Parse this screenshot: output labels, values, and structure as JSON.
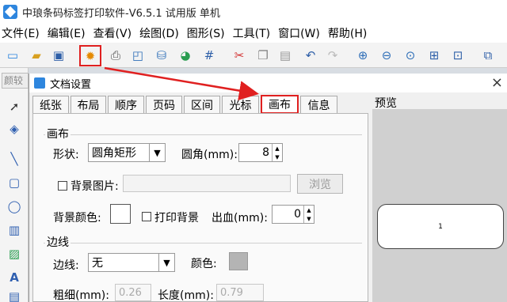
{
  "app": {
    "title": "中琅条码标签打印软件-V6.5.1 试用版 单机"
  },
  "menu": [
    "文件(E)",
    "编辑(E)",
    "查看(V)",
    "绘图(D)",
    "图形(S)",
    "工具(T)",
    "窗口(W)",
    "帮助(H)"
  ],
  "sidebar_ghost": "颜较",
  "dialog": {
    "title": "文档设置",
    "close": "×",
    "tabs": [
      "纸张",
      "布局",
      "顺序",
      "页码",
      "区间",
      "光标",
      "画布",
      "信息"
    ],
    "active_tab": "画布",
    "canvas_group": "画布",
    "shape_label": "形状:",
    "shape_value": "圆角矩形",
    "corner_label": "圆角(mm):",
    "corner_value": "8",
    "bg_image_label": "背景图片:",
    "browse_label": "浏览",
    "bg_color_label": "背景颜色:",
    "print_bg_label": "打印背景",
    "bleed_label": "出血(mm):",
    "bleed_value": "0",
    "border_group": "边线",
    "border_label": "边线:",
    "border_value": "无",
    "color_label": "颜色:",
    "thickness_label": "粗细(mm):",
    "thickness_value": "0.26",
    "length_label": "长度(mm):",
    "length_value": "0.79",
    "preview_label": "预览",
    "preview_page_number": "1"
  },
  "colors": {
    "highlight": "#e02020",
    "accent": "#2e86de",
    "border_color_swatch": "#b4b4b4"
  }
}
